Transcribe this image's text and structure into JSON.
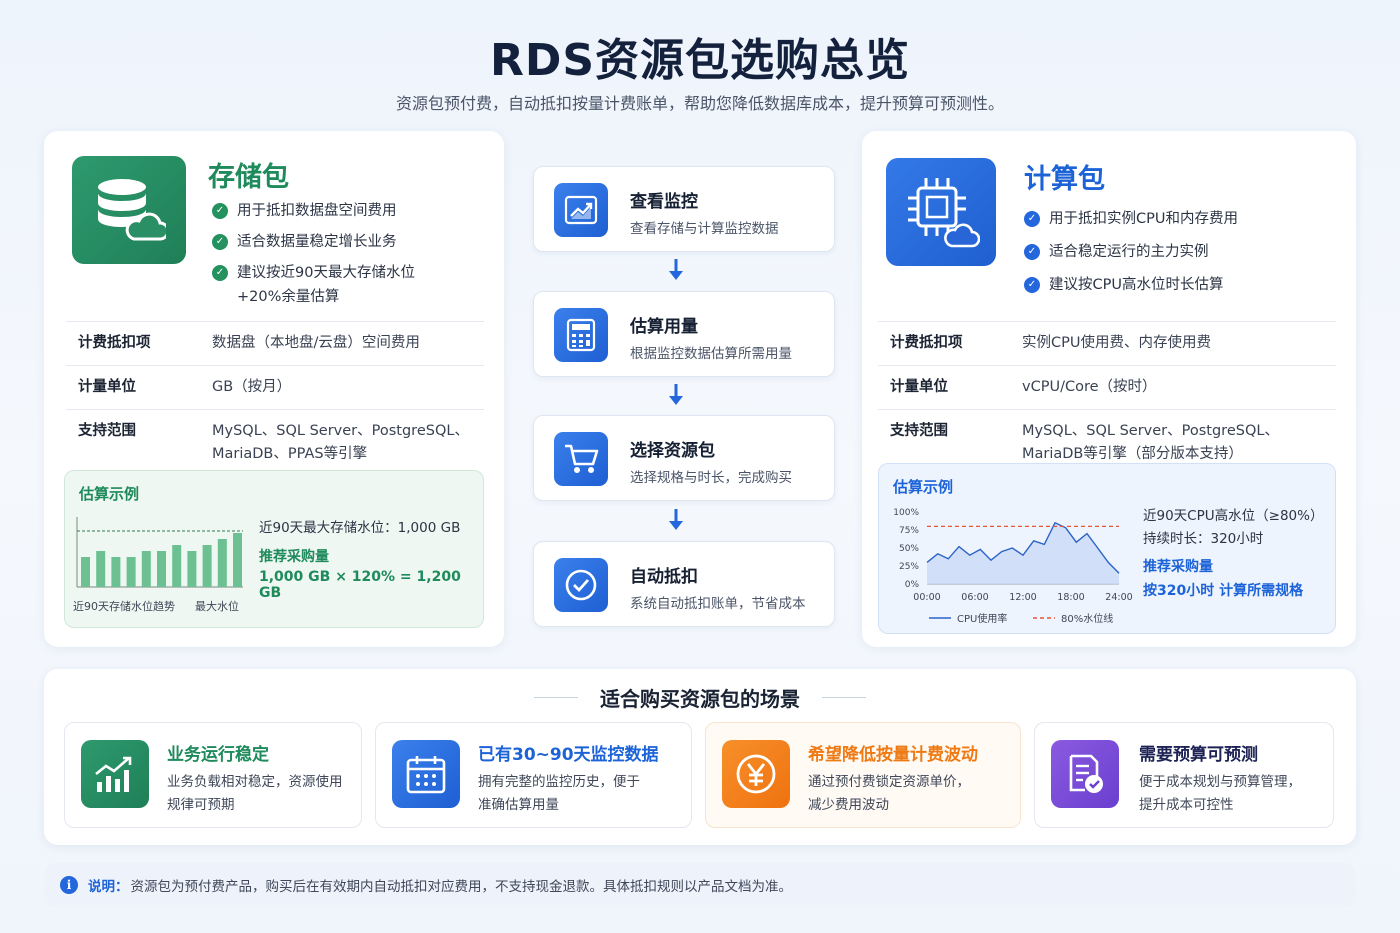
{
  "header": {
    "title": "RDS资源包选购总览",
    "subtitle": "资源包预付费，自动抵扣按量计费账单，帮助您降低数据库成本，提升预算可预测性。"
  },
  "storage": {
    "title": "存储包",
    "icon": "database-cloud-icon",
    "features": [
      "用于抵扣数据盘空间费用",
      "适合数据量稳定增长业务",
      "建议按近90天最大存储水位\n+20%余量估算"
    ],
    "table": [
      {
        "k": "计费抵扣项",
        "v": "数据盘（本地盘/云盘）空间费用"
      },
      {
        "k": "计量单位",
        "v": "GB（按月）"
      },
      {
        "k": "支持范围",
        "v": "MySQL、SQL Server、PostgreSQL、\nMariaDB、PPAS等引擎"
      }
    ],
    "example": {
      "title": "估算示例",
      "chart_caption_left": "近90天存储水位趋势",
      "chart_caption_right": "最大水位",
      "max_line": "近90天最大存储水位：1,000 GB",
      "rec_label": "推荐采购量",
      "rec_formula": "1,000 GB × 120% = 1,200 GB"
    }
  },
  "compute": {
    "title": "计算包",
    "icon": "cpu-chip-cloud-icon",
    "features": [
      "用于抵扣实例CPU和内存费用",
      "适合稳定运行的主力实例",
      "建议按CPU高水位时长估算"
    ],
    "table": [
      {
        "k": "计费抵扣项",
        "v": "实例CPU使用费、内存使用费"
      },
      {
        "k": "计量单位",
        "v": "vCPU/Core（按时）"
      },
      {
        "k": "支持范围",
        "v": "MySQL、SQL Server、PostgreSQL、\nMariaDB等引擎（部分版本支持）"
      }
    ],
    "example": {
      "title": "估算示例",
      "line1": "近90天CPU高水位（≥80%）",
      "line2": "持续时长：320小时",
      "rec_label": "推荐采购量",
      "rec_formula": "按320小时 计算所需规格",
      "legend_cpu": "CPU使用率",
      "legend_line": "80%水位线"
    }
  },
  "flow": [
    {
      "title": "查看监控",
      "desc": "查看存储与计算监控数据",
      "icon": "trend-chart-icon"
    },
    {
      "title": "估算用量",
      "desc": "根据监控数据估算所需用量",
      "icon": "calculator-icon"
    },
    {
      "title": "选择资源包",
      "desc": "选择规格与时长，完成购买",
      "icon": "cart-icon"
    },
    {
      "title": "自动抵扣",
      "desc": "系统自动抵扣账单，节省成本",
      "icon": "check-circle-icon"
    }
  ],
  "scenarios": {
    "title": "适合购买资源包的场景",
    "items": [
      {
        "name": "业务运行稳定",
        "desc": "业务负载相对稳定，资源使用\n规律可预期",
        "color": "#1f8a5b",
        "icon": "bar-growth-icon"
      },
      {
        "name": "已有30~90天监控数据",
        "desc": "拥有完整的监控历史，便于\n准确估算用量",
        "color": "#1d63d8",
        "icon": "calendar-icon"
      },
      {
        "name": "希望降低按量计费波动",
        "desc": "通过预付费锁定资源单价，\n减少费用波动",
        "color": "#ef7a14",
        "icon": "yen-coin-icon"
      },
      {
        "name": "需要预算可预测",
        "desc": "便于成本规划与预算管理，\n提升成本可控性",
        "color": "#2c2f6e",
        "icon": "document-check-icon"
      }
    ]
  },
  "note": {
    "label": "说明：",
    "text": "资源包为预付费产品，购买后在有效期内自动抵扣对应费用，不支持现金退款。具体抵扣规则以产品文档为准。"
  },
  "chart_data": [
    {
      "type": "bar",
      "values": [
        5,
        6,
        5,
        5,
        6,
        6,
        7,
        6,
        7,
        8,
        9
      ],
      "categories": [],
      "reference_line": "最大水位",
      "xlabel": "近90天存储水位趋势"
    },
    {
      "type": "area",
      "x_ticks": [
        "00:00",
        "06:00",
        "12:00",
        "18:00",
        "24:00"
      ],
      "y_ticks": [
        "100%",
        "75%",
        "50%",
        "25%",
        "0%"
      ],
      "ylim": [
        0,
        100
      ],
      "threshold": 80,
      "series": [
        {
          "name": "CPU使用率",
          "values": [
            30,
            42,
            35,
            52,
            40,
            48,
            33,
            45,
            50,
            40,
            60,
            55,
            85,
            78,
            58,
            70,
            50,
            30,
            15
          ]
        },
        {
          "name": "80%水位线",
          "values": [
            80
          ]
        }
      ]
    }
  ]
}
